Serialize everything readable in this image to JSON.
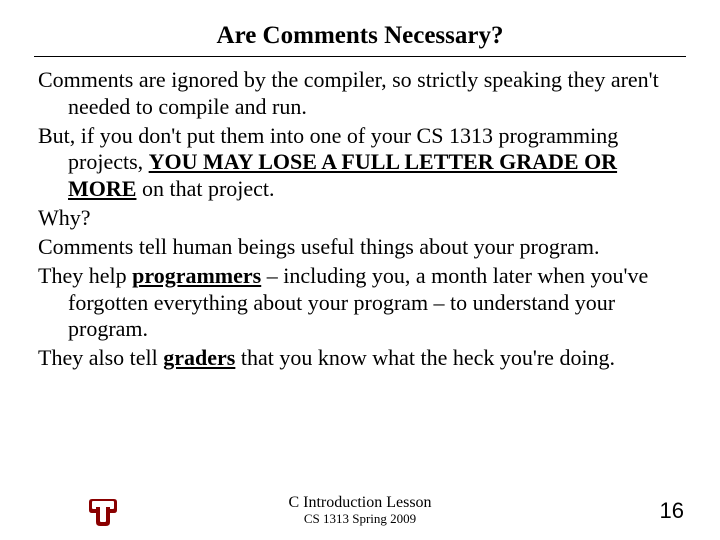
{
  "title": "Are Comments Necessary?",
  "paras": {
    "p1a": "Comments are ignored by the compiler, so strictly speaking they aren't needed to compile and run.",
    "p2_pre": "But, if you don't put them into one of your CS 1313 programming projects, ",
    "p2_emph": "YOU MAY LOSE A FULL LETTER GRADE OR MORE",
    "p2_post": " on that project.",
    "p3": "Why?",
    "p4": "Comments tell human beings useful things about your program.",
    "p5_pre": "They help ",
    "p5_emph": "programmers",
    "p5_post": " – including you, a month later when you've forgotten everything about your program – to understand your program.",
    "p6_pre": "They also tell ",
    "p6_emph": "graders",
    "p6_post": " that you know what the heck you're doing."
  },
  "footer": {
    "line1": "C Introduction Lesson",
    "line2": "CS 1313 Spring 2009"
  },
  "page_number": "16",
  "logo": {
    "name": "ou-logo",
    "color": "#8a0000"
  }
}
